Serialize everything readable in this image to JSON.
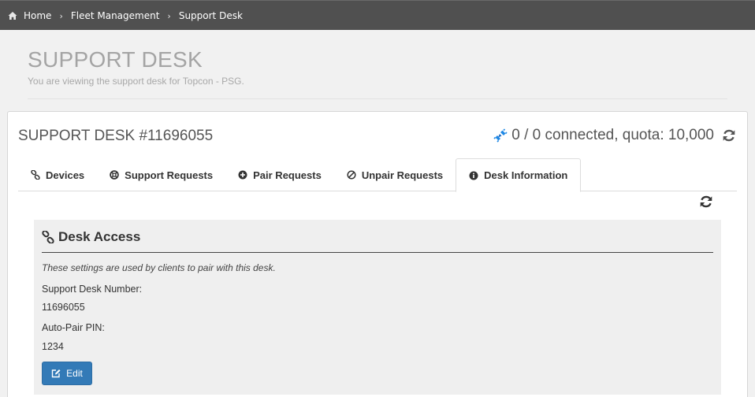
{
  "breadcrumb": {
    "items": [
      "Home",
      "Fleet Management"
    ],
    "current": "Support Desk"
  },
  "header": {
    "title": "SUPPORT DESK",
    "subtitle": "You are viewing the support desk for Topcon - PSG."
  },
  "desk": {
    "title": "SUPPORT DESK #11696055",
    "connection": "0 / 0 connected, quota: 10,000"
  },
  "tabs": [
    {
      "label": "Devices",
      "icon": "link-icon"
    },
    {
      "label": "Support Requests",
      "icon": "life-ring-icon"
    },
    {
      "label": "Pair Requests",
      "icon": "plus-circle-icon"
    },
    {
      "label": "Unpair Requests",
      "icon": "ban-icon"
    },
    {
      "label": "Desk Information",
      "icon": "info-circle-icon",
      "active": true
    }
  ],
  "panel": {
    "title": "Desk Access",
    "description": "These settings are used by clients to pair with this desk.",
    "fields": [
      {
        "label": "Support Desk Number:",
        "value": "11696055"
      },
      {
        "label": "Auto-Pair PIN:",
        "value": "1234"
      }
    ],
    "edit_label": "Edit"
  },
  "colors": {
    "topbar": "#505050",
    "primary_button": "#337ab7",
    "plug_icon": "#1e88e5"
  }
}
